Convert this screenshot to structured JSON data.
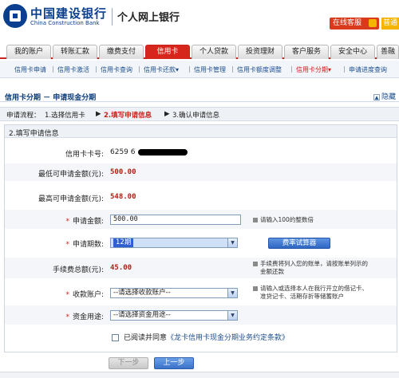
{
  "header": {
    "bank_name_cn": "中国建设银行",
    "bank_name_en": "China Construction Bank",
    "system_title": "个人网上银行",
    "online_service": "在线客服",
    "right_edge_label": "普通"
  },
  "tabs": [
    {
      "label": "我的账户"
    },
    {
      "label": "转账汇款"
    },
    {
      "label": "缴费支付"
    },
    {
      "label": "信用卡",
      "active": true
    },
    {
      "label": "个人贷款"
    },
    {
      "label": "投资理财"
    },
    {
      "label": "客户服务"
    },
    {
      "label": "安全中心"
    },
    {
      "label": "善融"
    }
  ],
  "subnav": {
    "items": [
      {
        "label": "信用卡申请"
      },
      {
        "label": "信用卡激活"
      },
      {
        "label": "信用卡查询"
      },
      {
        "label": "信用卡还款▾"
      },
      {
        "label": "信用卡管理"
      },
      {
        "label": "信用卡额度调整"
      },
      {
        "label": "信用卡分期▾",
        "active": true
      },
      {
        "label": "申请进度查询"
      }
    ],
    "separator": "|"
  },
  "page": {
    "title": "信用卡分期 － 申请现金分期",
    "hide_label": "隐藏",
    "hide_glyph": "▲"
  },
  "steps": {
    "prefix": "申请流程：",
    "step1": "1.选择信用卡",
    "arrow": "▶",
    "step2": "2.填写申请信息",
    "step3": "3.确认申请信息"
  },
  "form": {
    "section_title": "2.填写申请信息",
    "required_mark": "*",
    "card_number_label": "信用卡卡号:",
    "card_number_value": "6259 6",
    "min_amount_label": "最低可申请金额(元):",
    "min_amount_value": "500.00",
    "max_amount_label": "最高可申请金额(元):",
    "max_amount_value": "548.00",
    "apply_amount_label": "申请金额:",
    "apply_amount_value": "500.00",
    "apply_amount_hint": "请输入100的整数倍",
    "periods_label": "申请期数:",
    "periods_value": "12期",
    "calc_button": "费率试算器",
    "fee_label": "手续费总额(元):",
    "fee_value": "45.00",
    "fee_hint_line1": "手续费将列入您的账单，请按账单列示的",
    "fee_hint_line2": "金额还款",
    "receive_account_label": "收款账户:",
    "receive_account_value": "--请选择收款账户--",
    "receive_hint_line1": "请输入或选择本人在我行开立的借记卡、",
    "receive_hint_line2": "准贷记卡、活期存折等储蓄账户",
    "purpose_label": "资金用途:",
    "purpose_value": "--请选择资金用途--",
    "agree_prefix": "已阅读并同意",
    "agree_link": "《龙卡信用卡现金分期业务约定条款》"
  },
  "buttons": {
    "next": "下一步",
    "prev": "上一步"
  }
}
